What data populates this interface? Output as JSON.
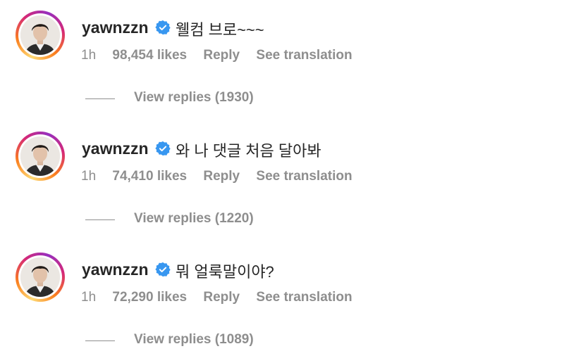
{
  "comments": [
    {
      "username": "yawnzzn",
      "text": "웰컴 브로~~~",
      "time": "1h",
      "likes": "98,454 likes",
      "reply_label": "Reply",
      "translate_label": "See translation",
      "view_replies": "View replies (1930)"
    },
    {
      "username": "yawnzzn",
      "text": "와 나 댓글 처음 달아봐",
      "time": "1h",
      "likes": "74,410 likes",
      "reply_label": "Reply",
      "translate_label": "See translation",
      "view_replies": "View replies (1220)"
    },
    {
      "username": "yawnzzn",
      "text": "뭐 얼룩말이야?",
      "time": "1h",
      "likes": "72,290 likes",
      "reply_label": "Reply",
      "translate_label": "See translation",
      "view_replies": "View replies (1089)"
    }
  ],
  "icons": {
    "verified": "verified-badge-icon"
  },
  "colors": {
    "verified_blue": "#3897f0",
    "meta_gray": "#8e8e8e",
    "text": "#262626"
  }
}
